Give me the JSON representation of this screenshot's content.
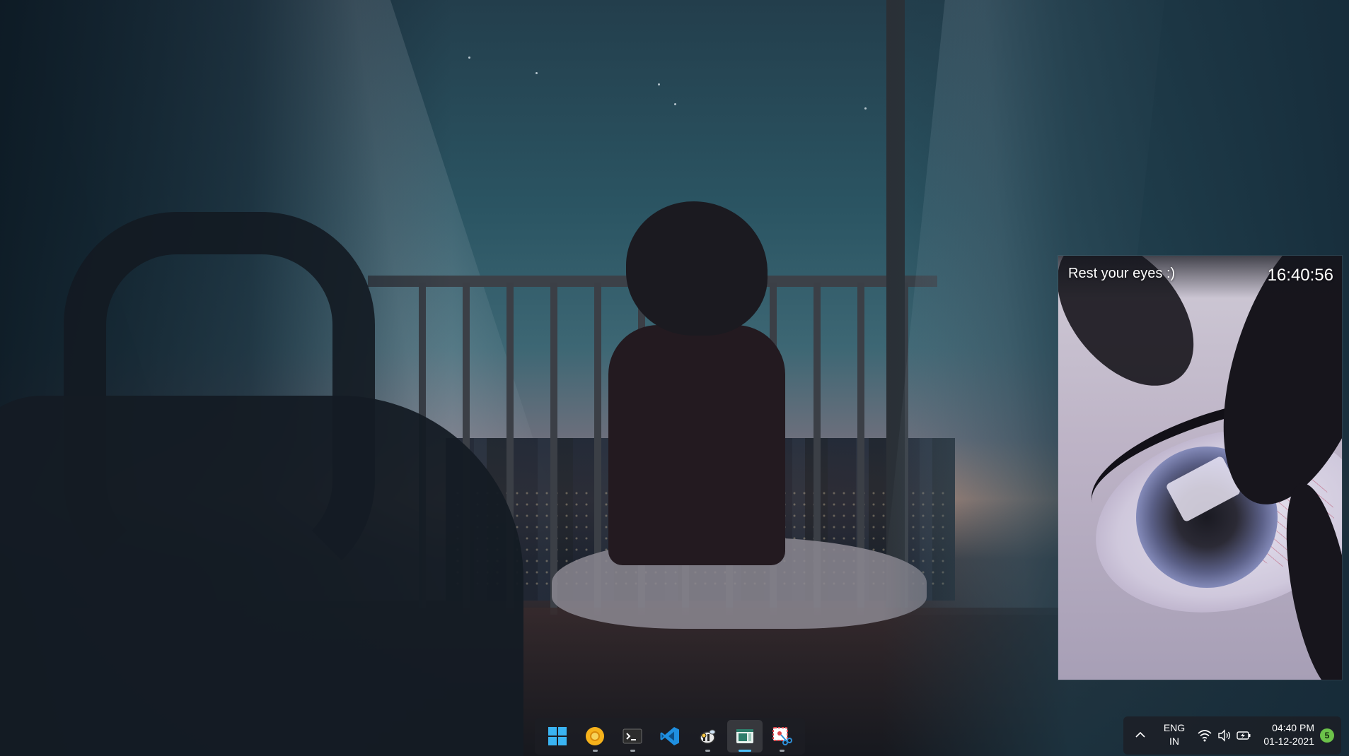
{
  "widget": {
    "title": "Rest your eyes :)",
    "clock": "16:40:56"
  },
  "taskbar": {
    "apps": [
      {
        "name": "Start",
        "icon": "windows-logo-icon",
        "running": false,
        "active": false
      },
      {
        "name": "Browser",
        "icon": "browser-icon",
        "running": true,
        "active": false
      },
      {
        "name": "Terminal",
        "icon": "terminal-icon",
        "running": true,
        "active": false
      },
      {
        "name": "Visual Studio Code",
        "icon": "vscode-icon",
        "running": false,
        "active": false
      },
      {
        "name": "Bee app",
        "icon": "bee-icon",
        "running": true,
        "active": false
      },
      {
        "name": "Break reminder app",
        "icon": "app-window-icon",
        "running": true,
        "active": true
      },
      {
        "name": "Snipping Tool",
        "icon": "snipping-tool-icon",
        "running": true,
        "active": false
      }
    ]
  },
  "tray": {
    "lang_line1": "ENG",
    "lang_line2": "IN",
    "time": "04:40 PM",
    "date": "01-12-2021",
    "notification_count": "5",
    "icons": [
      "chevron-up-icon",
      "wifi-icon",
      "volume-icon",
      "battery-charging-icon"
    ]
  },
  "colors": {
    "accent": "#4cc2ff",
    "badge": "#6cc24a",
    "taskbar_bg": "#1c1e24"
  }
}
